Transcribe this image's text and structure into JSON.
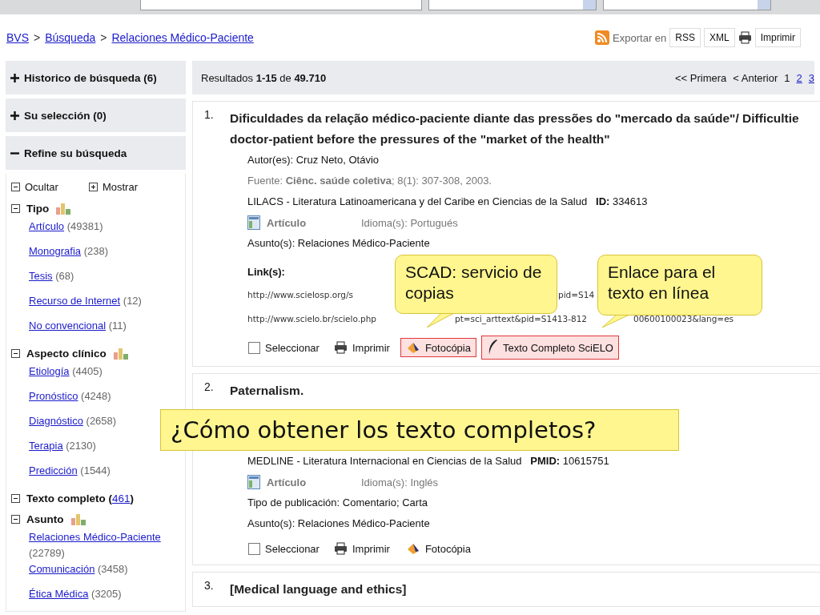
{
  "search_bar": {
    "fields": [
      {
        "kind": "input"
      },
      {
        "kind": "select"
      },
      {
        "kind": "select"
      }
    ]
  },
  "breadcrumb": [
    {
      "label": "BVS"
    },
    {
      "label": "Búsqueda"
    },
    {
      "label": "Relaciones Médico-Paciente"
    }
  ],
  "breadcrumb_separator": ">",
  "export": {
    "label": "Exportar en",
    "formats": [
      "RSS",
      "XML"
    ],
    "print": "Imprimir"
  },
  "sidebar": {
    "panels": [
      {
        "label": "Historico de búsqueda",
        "count": "(6)",
        "expanded": false
      },
      {
        "label": "Su selección",
        "count": "(0)",
        "expanded": false
      },
      {
        "label": "Refine su búsqueda",
        "expanded": true
      }
    ],
    "toggles": [
      {
        "label": "Ocultar",
        "expanded": true
      },
      {
        "label": "Mostrar",
        "expanded": false
      }
    ],
    "facets": [
      {
        "title": "Tipo",
        "chart": true,
        "expanded": true,
        "items": [
          {
            "label": "Artículo",
            "count": "(49381)"
          },
          {
            "label": "Monografia",
            "count": "(238)"
          },
          {
            "label": "Tesis",
            "count": "(68)"
          },
          {
            "label": "Recurso de Internet",
            "count": "(12)"
          },
          {
            "label": "No convencional",
            "count": "(11)"
          }
        ]
      },
      {
        "title": "Aspecto clínico",
        "chart": true,
        "expanded": true,
        "items": [
          {
            "label": "Etiología",
            "count": "(4405)"
          },
          {
            "label": "Pronóstico",
            "count": "(4248)"
          },
          {
            "label": "Diagnóstico",
            "count": "(2658)"
          },
          {
            "label": "Terapia",
            "count": "(2130)"
          },
          {
            "label": "Predicción",
            "count": "(1544)"
          }
        ]
      },
      {
        "title": "Texto completo (",
        "link": "461",
        "suffix": ")",
        "chart": false,
        "expanded": true
      },
      {
        "title": "Asunto",
        "chart": true,
        "expanded": true,
        "items": [
          {
            "label": "Relaciones Médico-Paciente",
            "count": "(22789)"
          },
          {
            "label": "Comunicación",
            "count": "(3458)"
          },
          {
            "label": "Ética Médica",
            "count": "(3205)"
          }
        ]
      }
    ]
  },
  "results_header": {
    "summary": "Resultados **1-15** de **49.710**",
    "pagination": [
      {
        "label": "<< Primera",
        "link": false
      },
      {
        "label": "< Anterior",
        "link": false
      },
      {
        "label": "1",
        "link": false
      },
      {
        "label": "2",
        "link": true
      },
      {
        "label": "3",
        "link": true
      }
    ]
  },
  "results": [
    {
      "number": "1.",
      "title": "Dificuldades da relação médico-paciente diante das pressões do \"mercado da saúde\"/ Difficultie\ndoctor-patient before the pressures of the \"market of the health\"",
      "author": "Autor(es): Cruz Neto, Otávio",
      "source": "Fuente: **Ciênc. saúde coletiva**; 8(1): 307-308, 2003.",
      "database": "LILACS - Literatura Latinoamericana y del Caribe en Ciencias de la Salud   **ID:** 334613",
      "type": "Artículo",
      "language": "Idioma(s): Portugués",
      "subject": "Asunto(s): Relaciones Médico-Paciente",
      "links_label": "Link(s):",
      "link_lines": [
        [
          "http://www.scielosp.org/s",
          "pid=S14"
        ],
        [
          "http://www.scielo.br/scielo.php",
          "pt=sci_arttext&pid=S1413-812",
          "00600100023&lang=es"
        ]
      ],
      "actions": [
        {
          "kind": "select",
          "label": "Seleccionar",
          "checked": false
        },
        {
          "kind": "print",
          "label": "Imprimir",
          "highlighted": false
        },
        {
          "kind": "photocopy",
          "label": "Fotocópia",
          "highlighted": true
        },
        {
          "kind": "fulltext",
          "label": "Texto Completo SciELO",
          "highlighted": true
        }
      ]
    },
    {
      "number": "2.",
      "title": "Paternalism.",
      "database": "MEDLINE - Literatura Internacional en Ciencias de la Salud   **PMID:** 10615751",
      "type": "Artículo",
      "language": "Idioma(s): Inglés",
      "pub_type": "Tipo de publicación: Comentario; Carta",
      "subject": "Asunto(s): Relaciones Médico-Paciente",
      "actions": [
        {
          "kind": "select",
          "label": "Seleccionar",
          "checked": false
        },
        {
          "kind": "print",
          "label": "Imprimir",
          "highlighted": false
        },
        {
          "kind": "photocopy",
          "label": "Fotocópia",
          "highlighted": false
        }
      ]
    },
    {
      "number": "3.",
      "title": "[Medical language and ethics]"
    }
  ],
  "callouts": [
    {
      "text": "SCAD: servicio de copias"
    },
    {
      "text": "Enlace para el texto en línea"
    }
  ],
  "headline": "¿Cómo obtener los texto completos?"
}
